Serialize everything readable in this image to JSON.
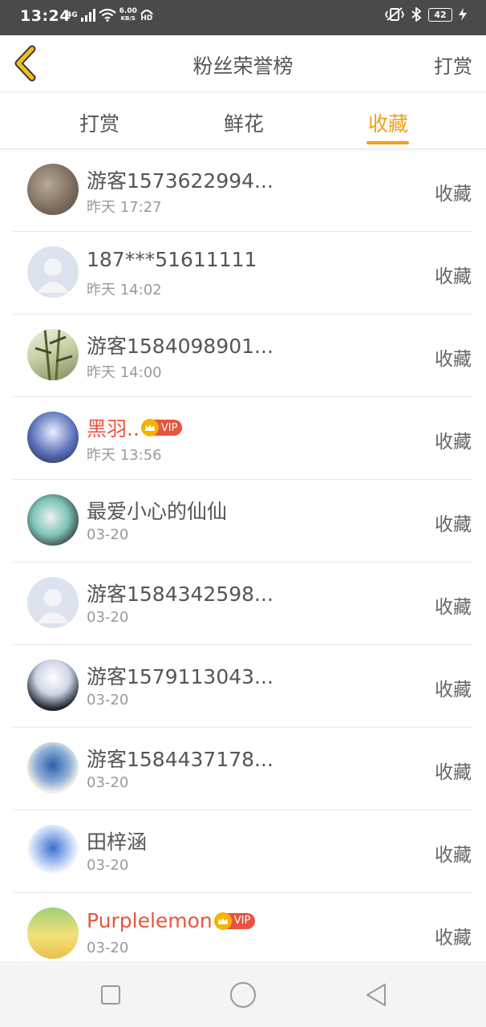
{
  "status_bar": {
    "time": "13:24",
    "network": "4G",
    "speed_value": "6.00",
    "speed_unit": "KB/S",
    "hd": "HD",
    "battery": "42"
  },
  "header": {
    "title": "粉丝荣誉榜",
    "action_label": "打赏",
    "accent_color": "#f0a020"
  },
  "tabs": [
    {
      "label": "打赏",
      "active": false
    },
    {
      "label": "鲜花",
      "active": false
    },
    {
      "label": "收藏",
      "active": true
    }
  ],
  "rows": [
    {
      "name": "游客1573622994...",
      "time": "昨天 17:27",
      "action": "收藏",
      "vip": false
    },
    {
      "name": "187***51611111",
      "time": "昨天 14:02",
      "action": "收藏",
      "vip": false
    },
    {
      "name": "游客1584098901...",
      "time": "昨天 14:00",
      "action": "收藏",
      "vip": false
    },
    {
      "name": "黑羽..",
      "time": "昨天 13:56",
      "action": "收藏",
      "vip": true,
      "vip_label": "VIP"
    },
    {
      "name": "最爱小心的仙仙",
      "time": "03-20",
      "action": "收藏",
      "vip": false
    },
    {
      "name": "游客1584342598...",
      "time": "03-20",
      "action": "收藏",
      "vip": false
    },
    {
      "name": "游客1579113043...",
      "time": "03-20",
      "action": "收藏",
      "vip": false
    },
    {
      "name": "游客1584437178...",
      "time": "03-20",
      "action": "收藏",
      "vip": false
    },
    {
      "name": "田梓涵",
      "time": "03-20",
      "action": "收藏",
      "vip": false
    },
    {
      "name": "Purplelemon",
      "time": "03-20",
      "action": "收藏",
      "vip": true,
      "vip_label": "VIP"
    }
  ]
}
